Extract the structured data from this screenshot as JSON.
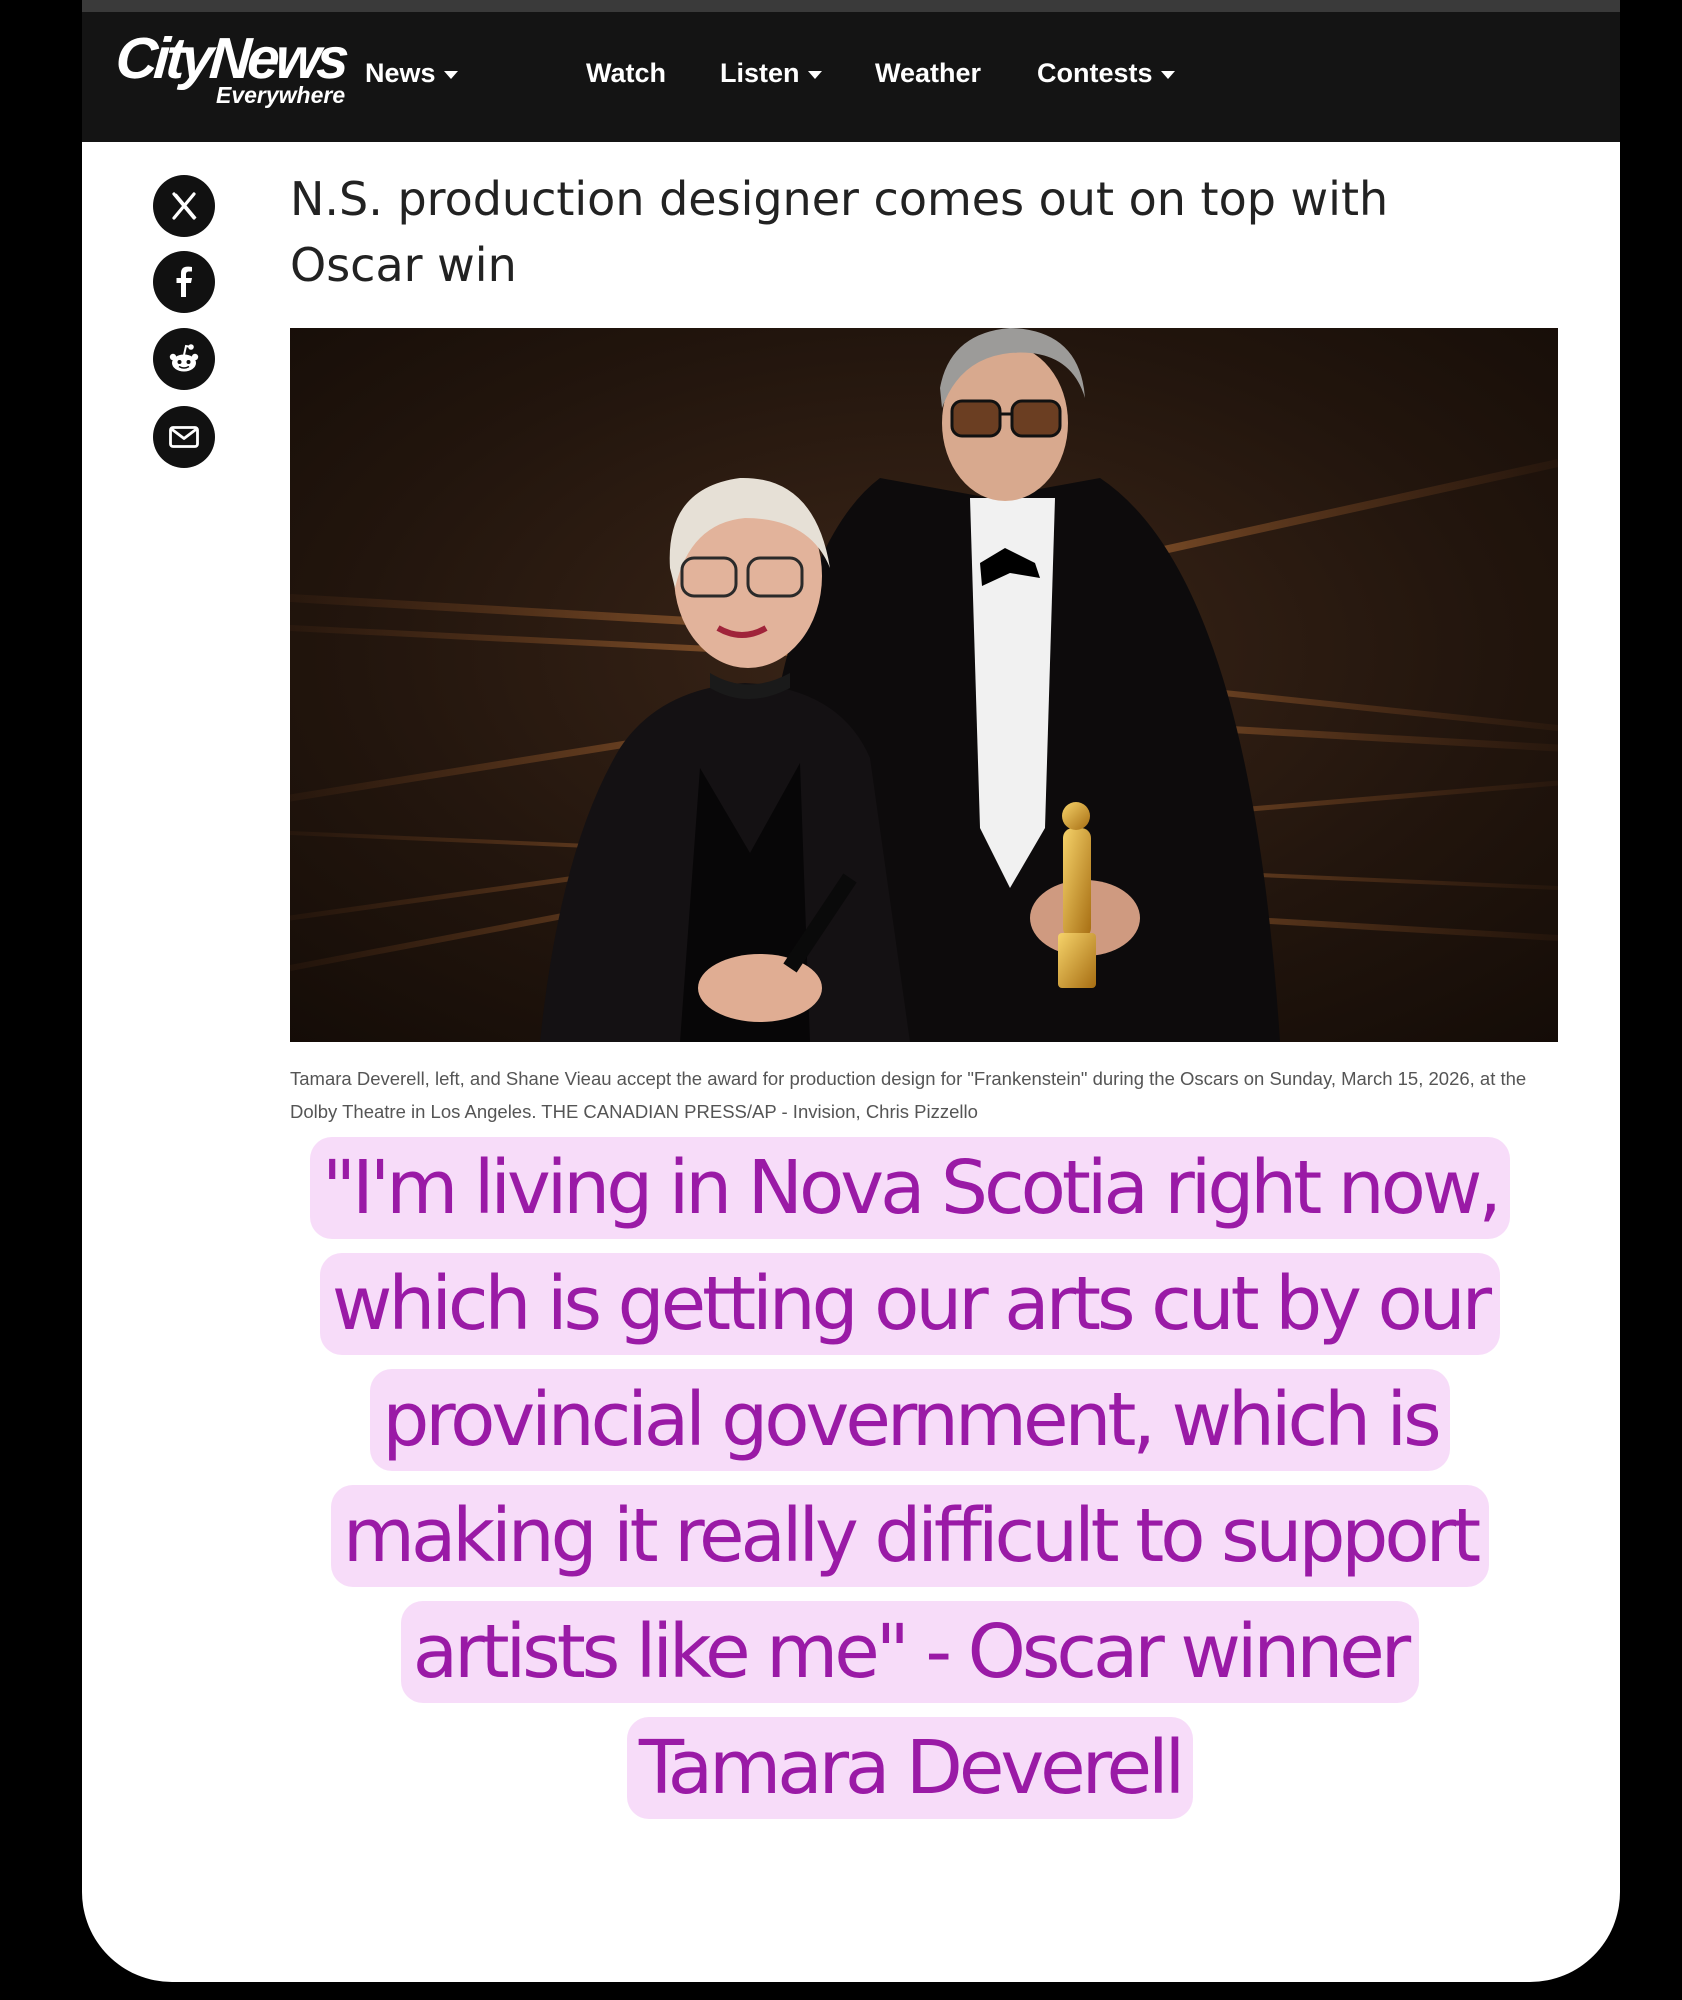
{
  "brand": {
    "logo_main": "CityNews",
    "logo_sub": "Everywhere"
  },
  "nav": {
    "items": [
      {
        "label": "News",
        "has_dropdown": true
      },
      {
        "label": "Watch",
        "has_dropdown": false
      },
      {
        "label": "Listen",
        "has_dropdown": true
      },
      {
        "label": "Weather",
        "has_dropdown": false
      },
      {
        "label": "Contests",
        "has_dropdown": true
      }
    ]
  },
  "share": {
    "icons": [
      "x-icon",
      "facebook-icon",
      "reddit-icon",
      "email-icon"
    ]
  },
  "article": {
    "headline": "N.S. production designer comes out on top with Oscar win",
    "photo_subject": "Tamara Deverell and Shane Vieau on stage at the Oscars holding an Oscar statuette",
    "caption": "Tamara Deverell, left, and Shane Vieau accept the award for production design for \"Frankenstein\" during the Oscars on Sunday, March 15, 2026, at the Dolby Theatre in Los Angeles. THE CANADIAN PRESS/AP - Invision, Chris Pizzello"
  },
  "overlay_quote": {
    "text": "\"I'm living in Nova Scotia right now, which is getting our arts cut by our provincial government, which is making it really difficult to support artists like me\" - Oscar winner Tamara Deverell"
  },
  "colors": {
    "navbar_bg": "#141414",
    "quote_bg": "#f7dcf9",
    "quote_text": "#9a1aa6",
    "headline_text": "#222222"
  }
}
